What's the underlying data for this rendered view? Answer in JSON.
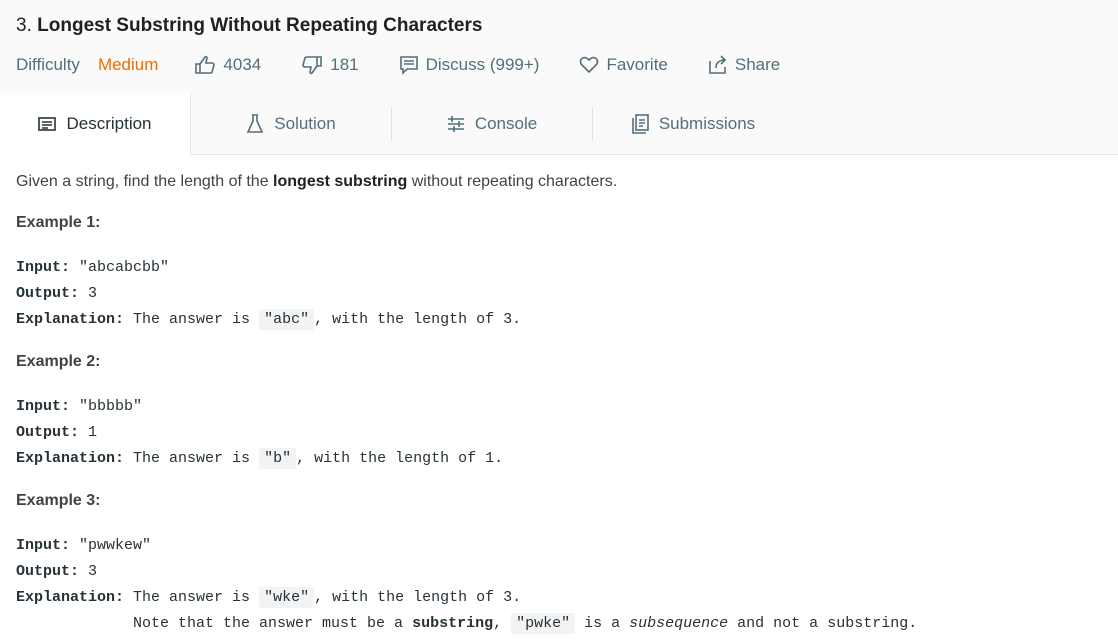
{
  "header": {
    "number": "3.",
    "title": "Longest Substring Without Repeating Characters",
    "difficulty_label": "Difficulty",
    "difficulty_value": "Medium",
    "likes": "4034",
    "dislikes": "181",
    "discuss": "Discuss (999+)",
    "favorite": "Favorite",
    "share": "Share"
  },
  "tabs": [
    {
      "label": "Description",
      "icon": "description-icon"
    },
    {
      "label": "Solution",
      "icon": "flask-icon"
    },
    {
      "label": "Console",
      "icon": "sliders-icon"
    },
    {
      "label": "Submissions",
      "icon": "submissions-icon"
    }
  ],
  "content": {
    "desc_pre": "Given a string, find the length of the ",
    "desc_bold": "longest substring",
    "desc_post": " without repeating characters.",
    "examples": [
      {
        "title": "Example 1:",
        "input_label": "Input:",
        "input_value": " \"abcabcbb\"",
        "output_label": "Output:",
        "output_value": " 3",
        "expl_label": "Explanation:",
        "expl_pre": " The answer is ",
        "expl_code": "\"abc\"",
        "expl_post": ", with the length of 3."
      },
      {
        "title": "Example 2:",
        "input_label": "Input:",
        "input_value": " \"bbbbb\"",
        "output_label": "Output:",
        "output_value": " 1",
        "expl_label": "Explanation:",
        "expl_pre": " The answer is ",
        "expl_code": "\"b\"",
        "expl_post": ", with the length of 1."
      },
      {
        "title": "Example 3:",
        "input_label": "Input:",
        "input_value": " \"pwwkew\"",
        "output_label": "Output:",
        "output_value": " 3",
        "expl_label": "Explanation:",
        "expl_pre": " The answer is ",
        "expl_code": "\"wke\"",
        "expl_post": ", with the length of 3.",
        "note_pre": "             Note that the answer must be a ",
        "note_bold": "substring",
        "note_mid": ", ",
        "note_code": "\"pwke\"",
        "note_mid2": " is a ",
        "note_italic": "subsequence",
        "note_post": " and not a substring."
      }
    ]
  }
}
